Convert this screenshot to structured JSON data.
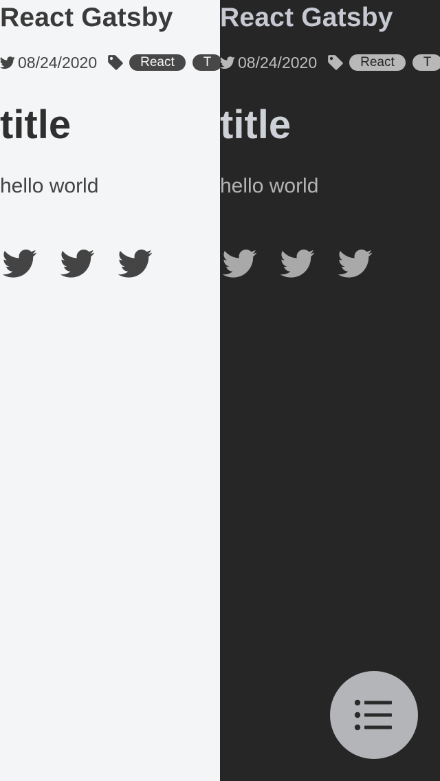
{
  "light_pane": {
    "site_title": "React Gatsby",
    "date": "08/24/2020",
    "tags": [
      "React",
      "T"
    ],
    "post_title": "title",
    "post_body": "hello world",
    "share_icons": [
      "twitter-icon",
      "twitter-icon",
      "twitter-icon"
    ]
  },
  "dark_pane": {
    "site_title": "React Gatsby",
    "date": "08/24/2020",
    "tags": [
      "React",
      "T"
    ],
    "post_title": "title",
    "post_body": "hello world",
    "share_icons": [
      "twitter-icon",
      "twitter-icon",
      "twitter-icon"
    ]
  },
  "fab": {
    "icon": "list-icon"
  },
  "colors": {
    "light_bg": "#f4f5f7",
    "light_text": "#3c3c3c",
    "dark_bg": "#262626",
    "dark_text": "#c8c9ce",
    "fab_bg": "#b4b5b8"
  }
}
